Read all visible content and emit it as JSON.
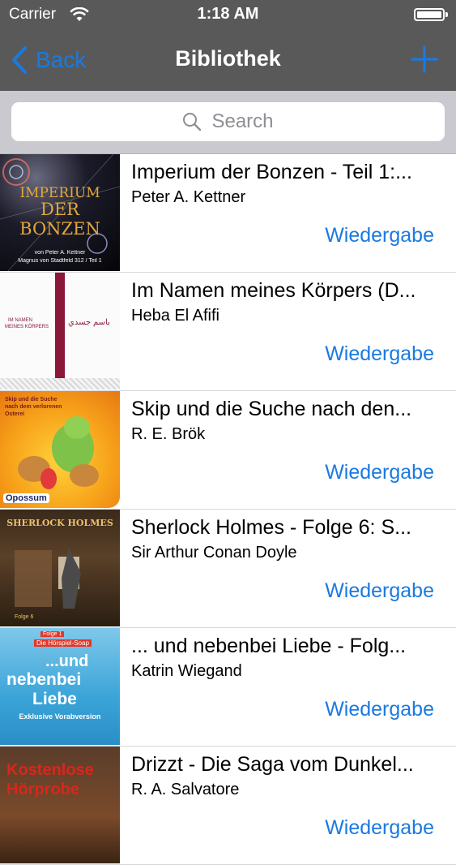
{
  "status": {
    "carrier": "Carrier",
    "time": "1:18 AM"
  },
  "nav": {
    "back_label": "Back",
    "title": "Bibliothek"
  },
  "search": {
    "placeholder": "Search"
  },
  "books": [
    {
      "title": "Imperium der Bonzen - Teil 1:...",
      "author": "Peter A. Kettner",
      "action": "Wiedergabe",
      "cover_text": [
        "IMPERIUM",
        "DER",
        "BONZEN",
        "von Peter A. Kettner",
        "Magnus von Stadtfeld 312 / Teil 1"
      ]
    },
    {
      "title": "Im Namen meines Körpers (D...",
      "author": "Heba El Afifi",
      "action": "Wiedergabe",
      "cover_text": [
        "IM NAMEN",
        "MEINES KÖRPERS",
        "باسم جسدي"
      ]
    },
    {
      "title": "Skip und die Suche nach den...",
      "author": "R. E. Brök",
      "action": "Wiedergabe",
      "cover_text": [
        "Skip und die Suche nach dem verlorenen Osterei",
        "Opossum"
      ]
    },
    {
      "title": "Sherlock Holmes - Folge 6: S...",
      "author": "Sir Arthur Conan Doyle",
      "action": "Wiedergabe",
      "cover_text": [
        "SHERLOCK HOLMES",
        "Folge 6"
      ]
    },
    {
      "title": "... und nebenbei Liebe - Folg...",
      "author": "Katrin Wiegand",
      "action": "Wiedergabe",
      "cover_text": [
        "Folge 1",
        "Die Hörspiel-Soap",
        "...und",
        "nebenbei",
        "Liebe",
        "Exklusive Vorabversion"
      ]
    },
    {
      "title": "Drizzt - Die Saga vom Dunkel...",
      "author": "R. A. Salvatore",
      "action": "Wiedergabe",
      "cover_text": [
        "Kostenlose",
        "Hörprobe"
      ]
    }
  ]
}
